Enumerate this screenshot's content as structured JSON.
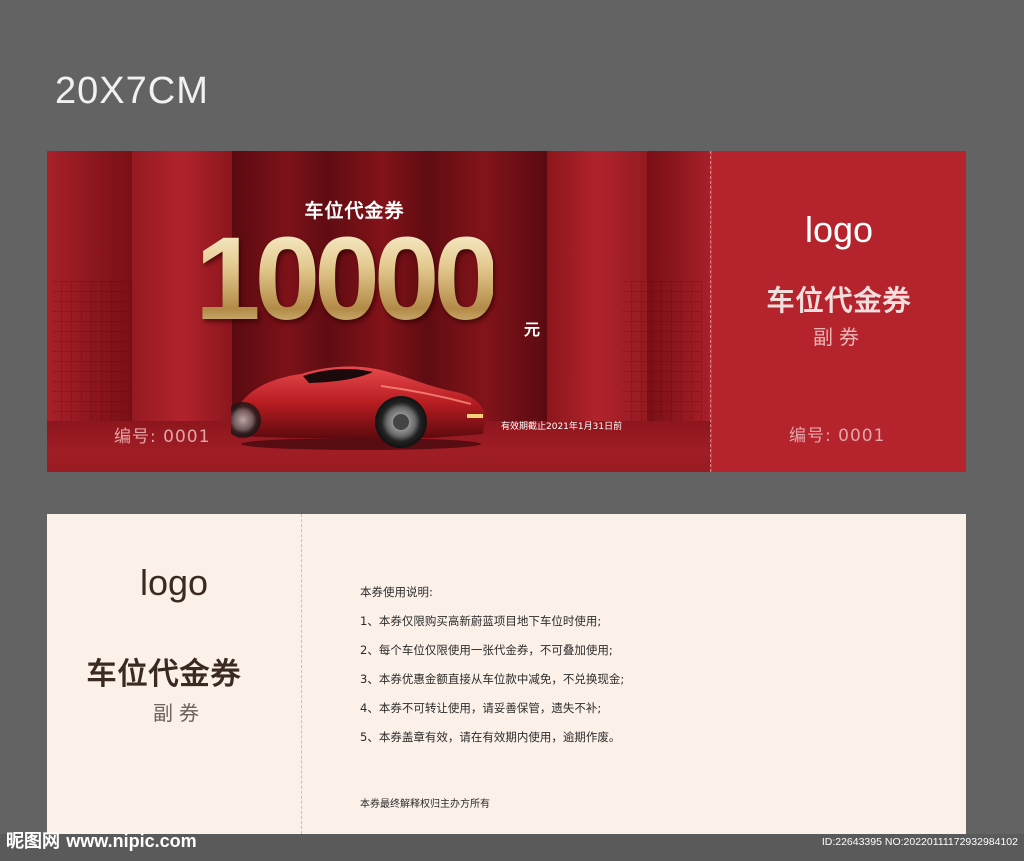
{
  "size_label": "20X7CM",
  "front": {
    "title": "车位代金券",
    "amount": "10000",
    "unit": "元",
    "serial": "编号: 0001",
    "validity": "有效期截止2021年1月31日前"
  },
  "front_stub": {
    "logo": "logo",
    "title": "车位代金券",
    "subtitle": "副券",
    "serial": "编号: 0001"
  },
  "back_stub": {
    "logo": "logo",
    "title": "车位代金券",
    "subtitle": "副券"
  },
  "instructions": {
    "heading": "本券使用说明:",
    "items": [
      "1、本券仅限购买高新蔚蓝项目地下车位时使用;",
      "2、每个车位仅限使用一张代金券，不可叠加使用;",
      "3、本券优惠金额直接从车位款中减免，不兑换现金;",
      "4、本券不可转让使用，请妥善保管，遗失不补;",
      "5、本券盖章有效，请在有效期内使用，逾期作废。"
    ],
    "footer": "本券最终解释权归主办方所有"
  },
  "watermark": {
    "brand": "昵图网",
    "site": "www.nipic.com",
    "id": "ID:22643395 NO:20220111172932984102"
  },
  "colors": {
    "background": "#636363",
    "front_red": "#9e1c23",
    "stub_red": "#b5242d",
    "back_cream": "#fbf1e8",
    "gold": "#e3c98f"
  }
}
